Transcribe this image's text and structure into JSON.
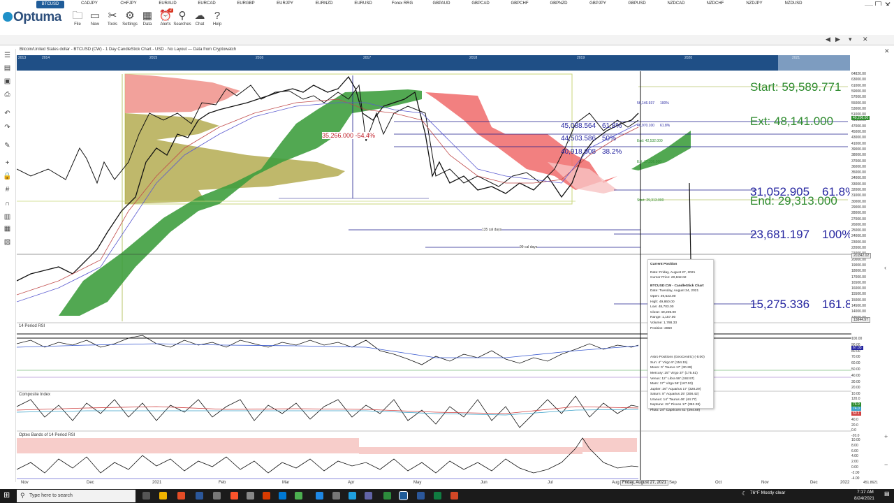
{
  "window": {
    "controls": [
      "—",
      "☐",
      "✕"
    ]
  },
  "ribbon": {
    "logo": "Optuma",
    "buttons": [
      {
        "label": "File",
        "icon": "folder-icon",
        "glyph": "🗀"
      },
      {
        "label": "New",
        "icon": "new-window-icon",
        "glyph": "▭"
      },
      {
        "label": "Tools",
        "icon": "tools-icon",
        "glyph": "✂"
      },
      {
        "label": "Settings",
        "icon": "gear-icon",
        "glyph": "⚙"
      },
      {
        "label": "Data",
        "icon": "data-icon",
        "glyph": "▦"
      },
      {
        "label": "Alerts",
        "icon": "alarm-clock-icon",
        "glyph": "⏰",
        "badge": "2"
      },
      {
        "label": "Searches",
        "icon": "search-icon",
        "glyph": "⚲"
      },
      {
        "label": "Chat",
        "icon": "chat-icon",
        "glyph": "☁"
      },
      {
        "label": "Help",
        "icon": "help-icon",
        "glyph": "?"
      }
    ]
  },
  "tabs": [
    "BTCUSD",
    "CADJPY",
    "CHFJPY",
    "EURAUD",
    "EURCAD",
    "EURGBP",
    "EURJPY",
    "EURNZD",
    "EURUSD",
    "Forex RRG",
    "GBPAUD",
    "GBPCAD",
    "GBPCHF",
    "GBPNZD",
    "GBPJPY",
    "GBPUSD",
    "NZDCAD",
    "NZDCHF",
    "NZDJPY",
    "NZDUSD"
  ],
  "active_tab": "BTCUSD",
  "chart": {
    "header": "Bitcoin/United States dollar - BTCUSD (CW) - 1 Day CandleStick Chart - USD - No Layout — Data from Cryptowatch",
    "timeline_years": [
      "2013",
      "2014",
      "2015",
      "2016",
      "2017",
      "2018",
      "2019",
      "2020",
      "2021"
    ],
    "fib": {
      "start": "Start: 59,589.771",
      "ext": "Ext: 48,141.000",
      "end": "End: 29,313.000",
      "l618": "31,052.905",
      "l618pct": "61.8%",
      "l100": "23,681.197",
      "l100pct": "100%",
      "l1618": "15,275.336",
      "l1618pct": "161.8"
    },
    "retrace": {
      "r1": "45,088.564",
      "r1pct": "61.8%",
      "r2": "44,503.586",
      "r2pct": "50%",
      "r3": "40,918.608",
      "r3pct": "38.2%"
    },
    "small_labels": {
      "a": "56,146.937",
      "a_pct": "100%",
      "b": "46,970.100",
      "b_pct": "61.8%",
      "c": "End: 42,532.000",
      "d": "Ext: 37,336.000",
      "e": "Start: 29,313.000"
    },
    "drawdown": "35,266.000  -54.4%",
    "cal1": "135 cal days",
    "cal2": "99 cal days",
    "price_axis": [
      "64820.00",
      "63000.00",
      "61000.00",
      "59000.00",
      "57000.00",
      "55000.00",
      "53000.00",
      "51000.00",
      "49000.00",
      "47000.00",
      "45000.00",
      "43000.00",
      "41000.00",
      "39000.00",
      "38000.00",
      "37000.00",
      "36000.00",
      "35000.00",
      "34000.00",
      "33000.00",
      "32000.00",
      "31000.00",
      "30000.00",
      "29000.00",
      "28000.00",
      "27000.00",
      "26000.00",
      "25000.00",
      "24000.00",
      "23000.00",
      "22000.00",
      "21000.00",
      "20000.00",
      "19000.00",
      "18000.00",
      "17000.00",
      "16500.00",
      "16000.00",
      "15500.00",
      "15000.00",
      "14500.00",
      "14000.00",
      "13500.00"
    ],
    "last_price": "49,206.00",
    "cursor_price": "20,842.02",
    "low_label": "13844.97",
    "rsi_title": "14 Period RSI",
    "rsi_axis": [
      "100.00",
      "90.00",
      "80.00",
      "70.00",
      "60.00",
      "50.00",
      "40.00",
      "30.00",
      "20.00",
      "10.00"
    ],
    "rsi_value": "67.03",
    "ci_title": "Composite Index",
    "ci_axis": [
      "120.0",
      "100.0",
      "80.0",
      "60.0",
      "40.0",
      "20.0",
      "0.0",
      "-20.0"
    ],
    "ci_values": [
      "76.9",
      "74.0",
      "60.1"
    ],
    "optex_title": "Optex Bands of 14 Period RSI",
    "optex_axis": [
      "10.00",
      "8.00",
      "6.00",
      "4.00",
      "2.00",
      "0.00",
      "-2.00",
      "-4.00"
    ],
    "x_axis": [
      "Nov",
      "Dec",
      "2021",
      "Feb",
      "Mar",
      "Apr",
      "May",
      "Jun",
      "Jul",
      "Aug",
      "Sep",
      "Oct",
      "Nov",
      "Dec",
      "2022"
    ],
    "cursor_date": "Friday, August 27, 2021",
    "bottom_value": "451.8621"
  },
  "popup": {
    "title": "Current Position",
    "lines": [
      "Date: Friday, August 27, 2021",
      "Cursor Price: 20,842.02"
    ],
    "sub": "BTCUSD:CW - CandleStick Chart",
    "data": [
      "Date: Tuesday, August 24, 2021",
      "Open: 49,523.00",
      "High: 49,860.00",
      "Low: 48,703.00",
      "Close: 49,206.00",
      "Range: 1,157.00",
      "Volume: 1,788.33",
      "Position: 2860"
    ],
    "astro_title": "Astro Positions (GeoCentric) (-5:00)",
    "astro": [
      "Sun: 4° Virgo 9' (154.15)",
      "Moon: 0° Taurus 17' (30.28)",
      "Mercury: 25° Virgo 37' (175.61)",
      "Venus: 12° Libra 58' (192.97)",
      "Mars: 17° Virgo 56' (167.93)",
      "Jupiter: 26° Aquarius 17' (328.29)",
      "Saturn: 8° Aquarius 25' (308.42)",
      "Uranus: 14° Taurus 46' (44.77)",
      "Neptune: 22° Pisces 17' (352.28)",
      "Pluto: 24° Capricorn 41' (294.69)"
    ]
  },
  "taskbar": {
    "search_placeholder": "Type here to search",
    "weather": "76°F  Mostly clear",
    "time": "7:17 AM",
    "date": "8/24/2021"
  }
}
